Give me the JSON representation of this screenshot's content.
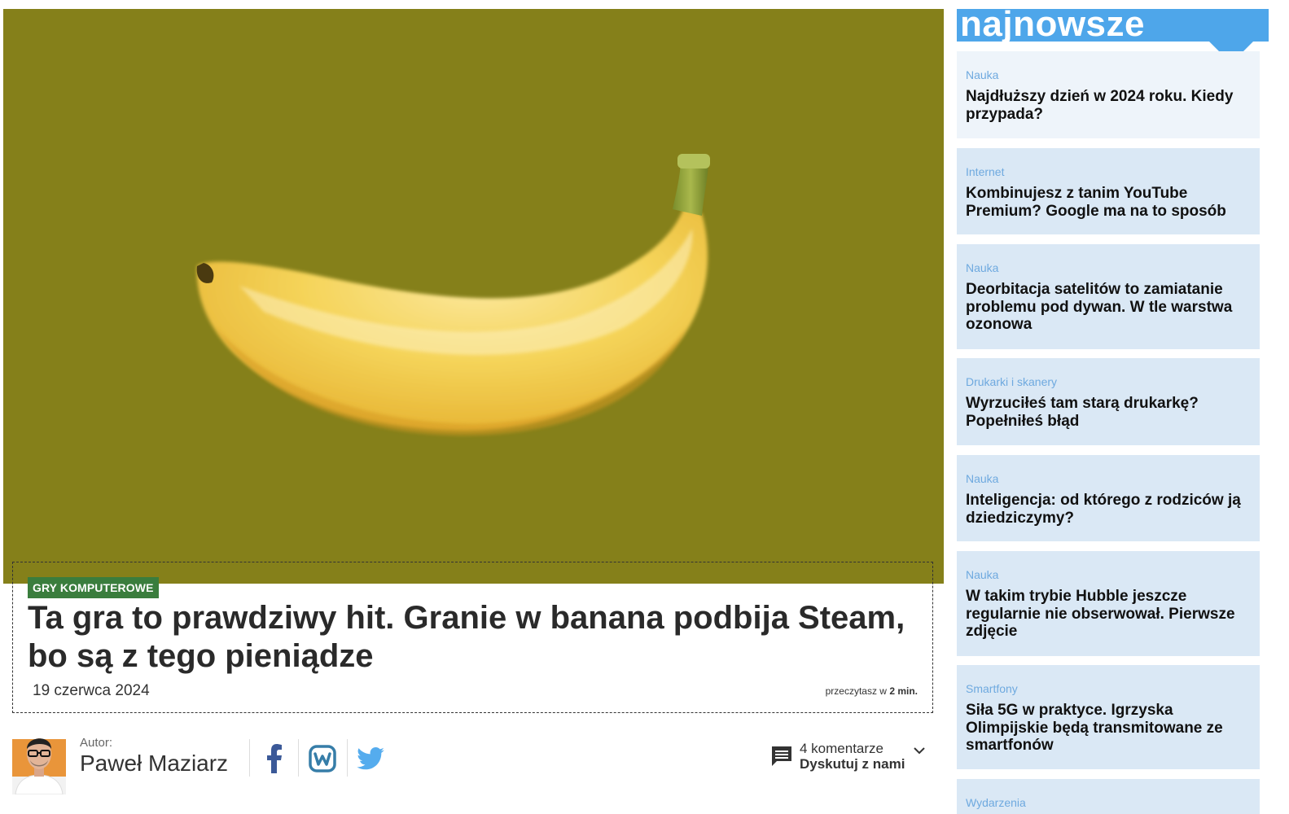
{
  "article": {
    "image_alt": "banana",
    "category": "GRY KOMPUTEROWE",
    "title": "Ta gra to prawdziwy hit. Granie w banana podbija Steam, bo są z tego pieniądze",
    "date": "19 czerwca 2024",
    "read_time_prefix": "przeczytasz w",
    "read_time_value": "2 min."
  },
  "author": {
    "label": "Autor:",
    "name": "Paweł Maziarz"
  },
  "social": [
    "facebook-icon",
    "wykop-icon",
    "twitter-icon"
  ],
  "comments": {
    "count_text": "4 komentarze",
    "cta": "Dyskutuj z nami"
  },
  "sidebar": {
    "title": "najnowsze",
    "items": [
      {
        "category": "Nauka",
        "title": "Najdłuższy dzień w 2024 roku. Kiedy przypada?"
      },
      {
        "category": "Internet",
        "title": "Kombinujesz z tanim YouTube Premium? Google ma na to sposób"
      },
      {
        "category": "Nauka",
        "title": "Deorbitacja satelitów to zamiatanie problemu pod dywan. W tle warstwa ozonowa"
      },
      {
        "category": "Drukarki i skanery",
        "title": "Wyrzuciłeś tam starą drukarkę? Popełniłeś błąd"
      },
      {
        "category": "Nauka",
        "title": "Inteligencja: od którego z rodziców ją dziedziczymy?"
      },
      {
        "category": "Nauka",
        "title": "W takim trybie Hubble jeszcze regularnie nie obserwował. Pierwsze zdjęcie"
      },
      {
        "category": "Smartfony",
        "title": "Siła 5G w praktyce. Igrzyska Olimpijskie będą transmitowane ze smartfonów"
      },
      {
        "category": "Wydarzenia",
        "title": ""
      }
    ]
  },
  "colors": {
    "hero_bg": "#85801a",
    "badge": "#3a7d3d",
    "sidebar_header": "#4ea6ea",
    "sidebar_item": "#dae8f5",
    "sidebar_category": "#6ea9df"
  }
}
